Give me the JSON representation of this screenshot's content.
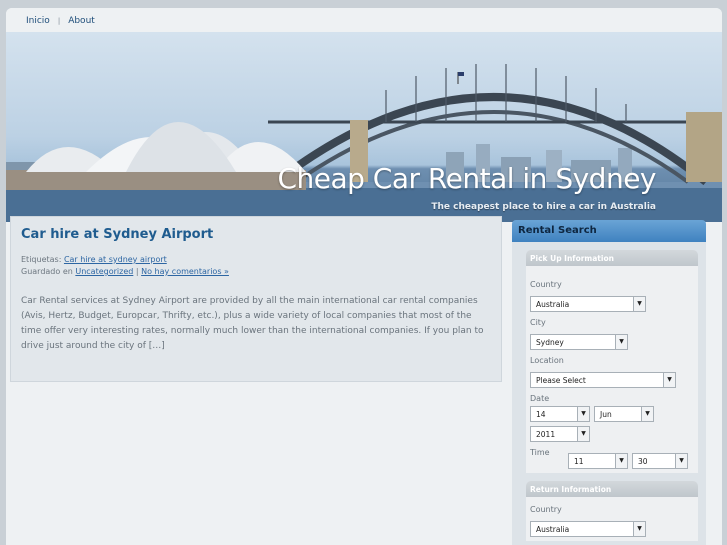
{
  "nav": {
    "items": [
      "Inicio",
      "About"
    ]
  },
  "header": {
    "title": "Cheap Car Rental in Sydney",
    "tagline": "The cheapest place to hire a car in Australia"
  },
  "post": {
    "title": "Car hire at Sydney Airport",
    "tags_label": "Etiquetas:",
    "tag_link": "Car hire at sydney airport",
    "saved_label": "Guardado en",
    "category_link": "Uncategorized",
    "separator": "|",
    "comments_link": "No hay comentarios »",
    "body": "Car Rental services at Sydney Airport are provided by all the main international car rental companies (Avis, Hertz, Budget, Europcar, Thrifty, etc.), plus a wide variety of local companies that most of the time offer very interesting rates, normally much lower than the international companies. If you plan to drive just around the city of […]"
  },
  "sidebar": {
    "title": "Rental Search",
    "pickup": {
      "heading": "Pick Up Information",
      "country_label": "Country",
      "country_value": "Australia",
      "city_label": "City",
      "city_value": "Sydney",
      "location_label": "Location",
      "location_value": "Please Select",
      "date_label": "Date",
      "day": "14",
      "month": "Jun",
      "year": "2011",
      "time_label": "Time",
      "hour": "11",
      "minute": "30"
    },
    "return": {
      "heading": "Return Information",
      "country_label": "Country",
      "country_value": "Australia"
    }
  },
  "icons": {
    "dropdown": "chevron-down-icon"
  },
  "colors": {
    "accent": "#1f5c8f",
    "link": "#2d66a3",
    "sidebar_header": "#3f82c0"
  }
}
